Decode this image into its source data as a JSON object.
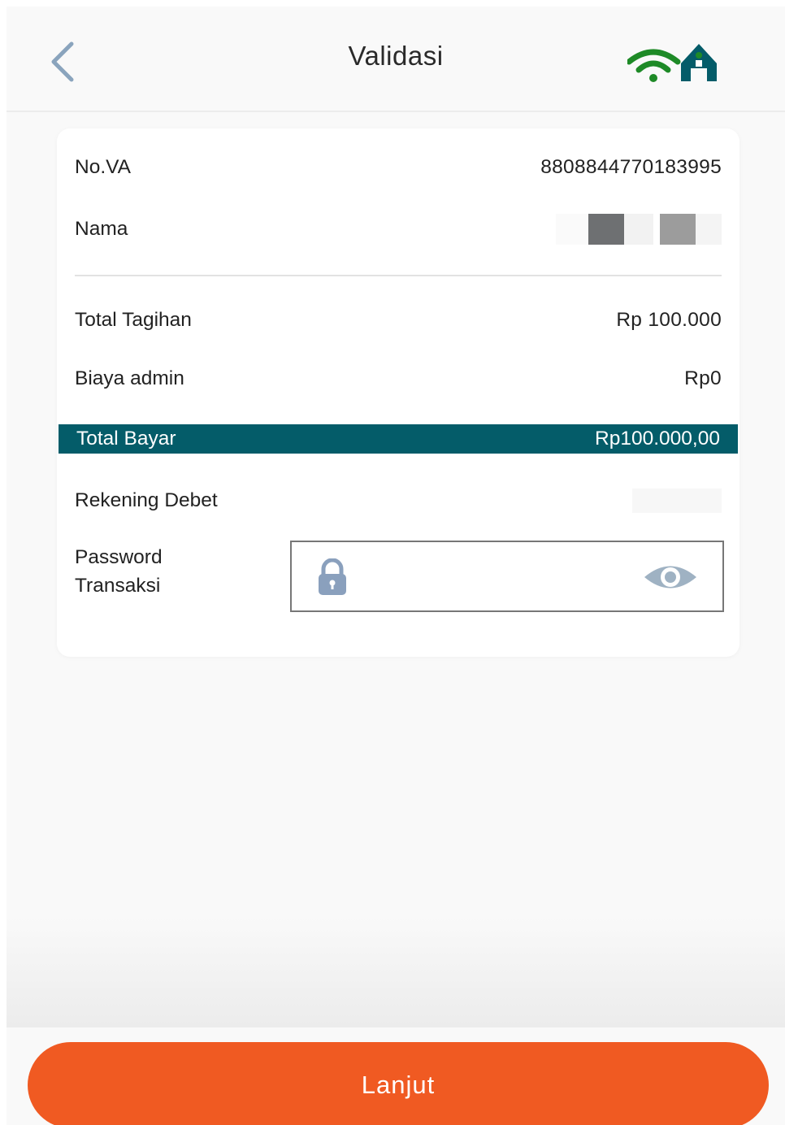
{
  "header": {
    "title": "Validasi",
    "icons": {
      "back": "chevron-left-icon",
      "logo": "wifi-home-logo"
    },
    "colors": {
      "logo_green": "#1e8a27",
      "logo_teal": "#045c69",
      "back": "#8aa4bd"
    }
  },
  "details": {
    "no_va": {
      "label": "No.VA",
      "value": "8808844770183995"
    },
    "nama": {
      "label": "Nama"
    },
    "total_tagihan": {
      "label": "Total Tagihan",
      "value": "Rp 100.000"
    },
    "biaya_admin": {
      "label": "Biaya admin",
      "value": "Rp0"
    },
    "total_bayar": {
      "label": "Total Bayar",
      "value": "Rp100.000,00",
      "color": "#045c69"
    },
    "rekening_debet": {
      "label": "Rekening Debet"
    }
  },
  "password": {
    "label_line1": "Password",
    "label_line2": "Transaksi",
    "icons": {
      "lock": "lock-icon",
      "toggle": "eye-icon"
    }
  },
  "submit": {
    "label": "Lanjut",
    "color": "#f05a22"
  }
}
